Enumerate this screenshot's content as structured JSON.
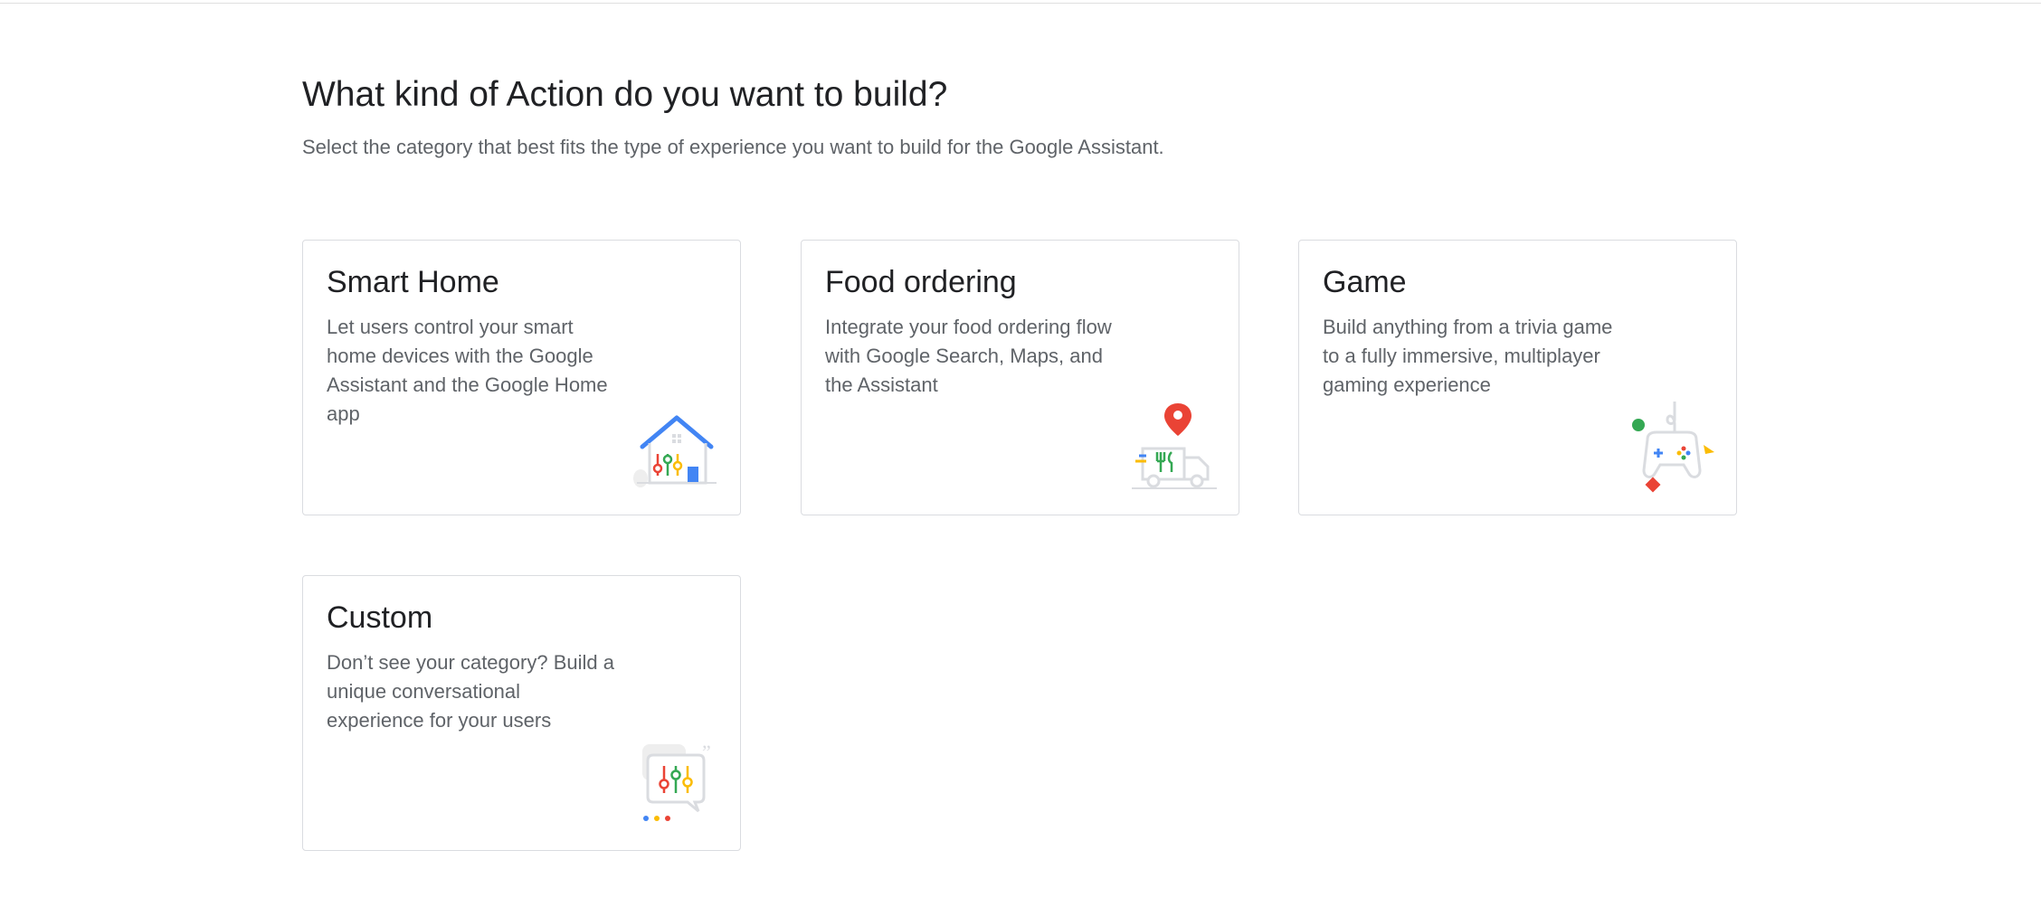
{
  "page": {
    "title": "What kind of Action do you want to build?",
    "subtitle": "Select the category that best fits the type of experience you want to build for the Google Assistant."
  },
  "cards": [
    {
      "title": "Smart Home",
      "description": "Let users control your smart home devices with the Google Assistant and the Google Home app",
      "icon": "smart-home-illustration"
    },
    {
      "title": "Food ordering",
      "description": "Integrate your food ordering flow with Google Search, Maps, and the Assistant",
      "icon": "food-truck-illustration"
    },
    {
      "title": "Game",
      "description": "Build anything from a trivia game to a fully immersive, multiplayer gaming experience",
      "icon": "game-controller-illustration"
    },
    {
      "title": "Custom",
      "description": "Don’t see your category? Build a unique conversational experience for your users",
      "icon": "chat-sliders-illustration"
    }
  ],
  "colors": {
    "blue": "#4285F4",
    "red": "#EA4335",
    "yellow": "#FBBC04",
    "green": "#34A853",
    "grey": "#dadce0"
  }
}
